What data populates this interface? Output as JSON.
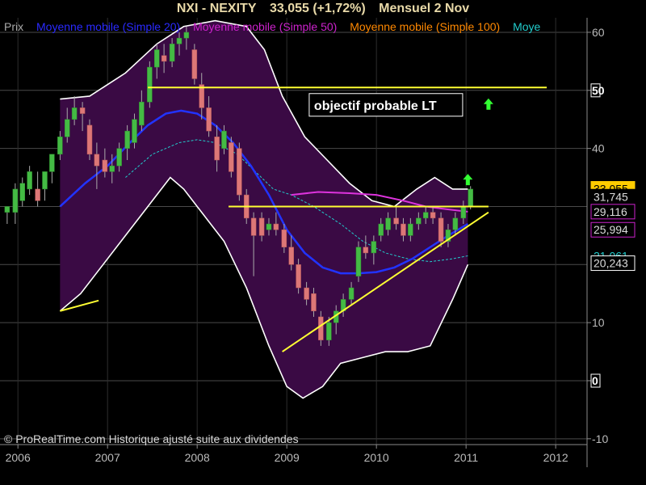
{
  "header": {
    "symbol": "NXI - NEXITY",
    "price_change": "33,055 (+1,72%)",
    "period": "Mensuel  2 Nov"
  },
  "legend": [
    {
      "label": "Prix",
      "color": "#aaaaaa"
    },
    {
      "label": "Moyenne mobile (Simple 20)",
      "color": "#2a2aff"
    },
    {
      "label": "Moyenne mobile (Simple 50)",
      "color": "#cc22cc"
    },
    {
      "label": "Moyenne mobile (Simple 100)",
      "color": "#ff8800"
    },
    {
      "label": "Moye",
      "color": "#22cccc"
    }
  ],
  "copyright": "© ProRealTime.com Historique ajusté suite aux dividendes",
  "annotation": {
    "text": "objectif probable LT",
    "x": 2009.25,
    "y": 47.5
  },
  "price_tags": [
    {
      "value": 33.055,
      "label": "33,055",
      "bg": "#ffcc00",
      "fg": "#000000",
      "border": "#ffcc00"
    },
    {
      "value": 31.7,
      "label": "31,745",
      "bg": "#000000",
      "fg": "#dddddd",
      "border": "#000000"
    },
    {
      "value": 29.116,
      "label": "29,116",
      "bg": "#000000",
      "fg": "#dddddd",
      "border": "#cc22cc"
    },
    {
      "value": 25.994,
      "label": "25,994",
      "bg": "#000000",
      "fg": "#dddddd",
      "border": "#cc22cc"
    },
    {
      "value": 21.5,
      "label": "21,061",
      "bg": "#000000",
      "fg": "#22cccc",
      "border": "#000000"
    },
    {
      "value": 20.243,
      "label": "20,243",
      "bg": "#000000",
      "fg": "#dddddd",
      "border": "#ffffff"
    }
  ],
  "chart_data": {
    "type": "candlestick",
    "x_axis": {
      "min": 2005.8,
      "max": 2012.35,
      "ticks": [
        "2006",
        "2007",
        "2008",
        "2009",
        "2010",
        "2011",
        "2012"
      ],
      "tick_values": [
        2006,
        2007,
        2008,
        2009,
        2010,
        2011,
        2012
      ]
    },
    "y_axis": {
      "min": -11,
      "max": 62.5,
      "ticks": [
        "60",
        "50",
        "40",
        "0",
        "10",
        "-10"
      ],
      "tick_values": [
        60,
        50,
        40,
        0,
        10,
        -10
      ],
      "highlight": [
        50,
        0
      ],
      "gridlines": [
        60,
        50,
        40,
        30,
        20,
        10,
        0,
        -10
      ]
    },
    "candles": [
      {
        "t": 2005.88,
        "o": 29,
        "h": 30,
        "l": 27,
        "c": 30
      },
      {
        "t": 2005.97,
        "o": 29,
        "h": 34,
        "l": 27,
        "c": 33
      },
      {
        "t": 2006.05,
        "o": 31,
        "h": 35,
        "l": 30,
        "c": 34
      },
      {
        "t": 2006.13,
        "o": 33,
        "h": 37,
        "l": 32,
        "c": 36
      },
      {
        "t": 2006.22,
        "o": 33,
        "h": 36,
        "l": 30,
        "c": 31
      },
      {
        "t": 2006.3,
        "o": 33,
        "h": 36,
        "l": 31,
        "c": 36
      },
      {
        "t": 2006.38,
        "o": 36,
        "h": 39,
        "l": 34,
        "c": 39
      },
      {
        "t": 2006.47,
        "o": 39,
        "h": 43,
        "l": 38,
        "c": 42
      },
      {
        "t": 2006.55,
        "o": 42,
        "h": 47,
        "l": 41,
        "c": 45
      },
      {
        "t": 2006.63,
        "o": 45,
        "h": 49,
        "l": 44,
        "c": 47
      },
      {
        "t": 2006.72,
        "o": 47,
        "h": 48,
        "l": 43,
        "c": 46
      },
      {
        "t": 2006.8,
        "o": 44,
        "h": 45,
        "l": 38,
        "c": 39
      },
      {
        "t": 2006.88,
        "o": 39,
        "h": 41,
        "l": 33,
        "c": 37
      },
      {
        "t": 2006.97,
        "o": 38,
        "h": 40,
        "l": 35,
        "c": 36
      },
      {
        "t": 2007.05,
        "o": 36,
        "h": 39,
        "l": 34,
        "c": 37
      },
      {
        "t": 2007.13,
        "o": 37,
        "h": 41,
        "l": 36,
        "c": 40
      },
      {
        "t": 2007.22,
        "o": 40,
        "h": 44,
        "l": 38,
        "c": 43
      },
      {
        "t": 2007.3,
        "o": 41,
        "h": 46,
        "l": 40,
        "c": 45
      },
      {
        "t": 2007.38,
        "o": 44,
        "h": 50,
        "l": 43,
        "c": 48
      },
      {
        "t": 2007.47,
        "o": 48,
        "h": 55,
        "l": 47,
        "c": 54
      },
      {
        "t": 2007.55,
        "o": 54,
        "h": 58,
        "l": 52,
        "c": 57
      },
      {
        "t": 2007.63,
        "o": 56,
        "h": 58,
        "l": 53,
        "c": 55
      },
      {
        "t": 2007.72,
        "o": 55,
        "h": 59,
        "l": 54,
        "c": 58
      },
      {
        "t": 2007.8,
        "o": 58,
        "h": 60,
        "l": 56,
        "c": 59
      },
      {
        "t": 2007.88,
        "o": 59,
        "h": 61,
        "l": 57,
        "c": 60
      },
      {
        "t": 2007.97,
        "o": 57,
        "h": 58,
        "l": 51,
        "c": 52
      },
      {
        "t": 2008.05,
        "o": 51,
        "h": 53,
        "l": 45,
        "c": 47
      },
      {
        "t": 2008.13,
        "o": 47,
        "h": 49,
        "l": 42,
        "c": 43
      },
      {
        "t": 2008.22,
        "o": 42,
        "h": 44,
        "l": 36,
        "c": 38
      },
      {
        "t": 2008.3,
        "o": 40,
        "h": 44,
        "l": 39,
        "c": 43
      },
      {
        "t": 2008.38,
        "o": 41,
        "h": 42,
        "l": 35,
        "c": 36
      },
      {
        "t": 2008.47,
        "o": 40,
        "h": 41,
        "l": 31,
        "c": 32
      },
      {
        "t": 2008.55,
        "o": 32,
        "h": 33,
        "l": 27,
        "c": 28
      },
      {
        "t": 2008.63,
        "o": 28,
        "h": 29,
        "l": 18,
        "c": 25
      },
      {
        "t": 2008.72,
        "o": 28,
        "h": 29,
        "l": 24,
        "c": 25
      },
      {
        "t": 2008.8,
        "o": 26,
        "h": 28,
        "l": 25,
        "c": 27
      },
      {
        "t": 2008.88,
        "o": 27,
        "h": 29,
        "l": 25,
        "c": 26
      },
      {
        "t": 2008.97,
        "o": 26,
        "h": 27,
        "l": 22,
        "c": 23
      },
      {
        "t": 2009.05,
        "o": 23,
        "h": 25,
        "l": 19,
        "c": 20
      },
      {
        "t": 2009.13,
        "o": 20,
        "h": 21,
        "l": 15,
        "c": 16
      },
      {
        "t": 2009.22,
        "o": 16,
        "h": 17,
        "l": 13,
        "c": 14
      },
      {
        "t": 2009.3,
        "o": 15,
        "h": 16,
        "l": 11,
        "c": 12
      },
      {
        "t": 2009.38,
        "o": 11,
        "h": 12,
        "l": 6,
        "c": 7
      },
      {
        "t": 2009.47,
        "o": 7,
        "h": 11,
        "l": 6,
        "c": 10
      },
      {
        "t": 2009.55,
        "o": 10,
        "h": 13,
        "l": 8,
        "c": 12
      },
      {
        "t": 2009.63,
        "o": 12,
        "h": 15,
        "l": 11,
        "c": 14
      },
      {
        "t": 2009.72,
        "o": 14,
        "h": 17,
        "l": 13,
        "c": 16
      },
      {
        "t": 2009.8,
        "o": 18,
        "h": 24,
        "l": 17,
        "c": 23
      },
      {
        "t": 2009.88,
        "o": 23,
        "h": 25,
        "l": 21,
        "c": 22
      },
      {
        "t": 2009.97,
        "o": 22,
        "h": 25,
        "l": 20,
        "c": 24
      },
      {
        "t": 2010.05,
        "o": 25,
        "h": 28,
        "l": 24,
        "c": 27
      },
      {
        "t": 2010.13,
        "o": 26,
        "h": 29,
        "l": 25,
        "c": 28
      },
      {
        "t": 2010.22,
        "o": 28,
        "h": 30,
        "l": 26,
        "c": 27
      },
      {
        "t": 2010.3,
        "o": 27,
        "h": 28,
        "l": 24,
        "c": 25
      },
      {
        "t": 2010.38,
        "o": 25,
        "h": 28,
        "l": 24,
        "c": 27
      },
      {
        "t": 2010.47,
        "o": 27,
        "h": 29,
        "l": 26,
        "c": 28
      },
      {
        "t": 2010.55,
        "o": 28,
        "h": 30,
        "l": 27,
        "c": 29
      },
      {
        "t": 2010.63,
        "o": 29,
        "h": 30,
        "l": 27,
        "c": 28
      },
      {
        "t": 2010.72,
        "o": 28,
        "h": 29,
        "l": 23,
        "c": 24
      },
      {
        "t": 2010.8,
        "o": 24,
        "h": 27,
        "l": 23,
        "c": 26
      },
      {
        "t": 2010.88,
        "o": 26,
        "h": 29,
        "l": 25,
        "c": 28
      },
      {
        "t": 2010.97,
        "o": 28,
        "h": 31,
        "l": 27,
        "c": 30
      },
      {
        "t": 2011.05,
        "o": 30,
        "h": 33.5,
        "l": 29.5,
        "c": 33
      }
    ],
    "bollinger_upper": [
      [
        2006.47,
        48.5
      ],
      [
        2006.8,
        49
      ],
      [
        2007.2,
        53
      ],
      [
        2007.55,
        58
      ],
      [
        2007.85,
        61
      ],
      [
        2008.2,
        62
      ],
      [
        2008.55,
        61
      ],
      [
        2008.75,
        57
      ],
      [
        2008.95,
        49
      ],
      [
        2009.2,
        42
      ],
      [
        2009.45,
        38
      ],
      [
        2009.7,
        34
      ],
      [
        2009.95,
        31
      ],
      [
        2010.2,
        30
      ],
      [
        2010.45,
        33
      ],
      [
        2010.65,
        35
      ],
      [
        2010.85,
        33
      ],
      [
        2011.02,
        33
      ]
    ],
    "bollinger_lower": [
      [
        2006.47,
        12
      ],
      [
        2006.7,
        15
      ],
      [
        2006.95,
        20
      ],
      [
        2007.2,
        25
      ],
      [
        2007.5,
        31
      ],
      [
        2007.7,
        35
      ],
      [
        2007.85,
        33
      ],
      [
        2008.05,
        29
      ],
      [
        2008.3,
        24
      ],
      [
        2008.55,
        16
      ],
      [
        2008.8,
        6
      ],
      [
        2009.0,
        -1
      ],
      [
        2009.18,
        -3
      ],
      [
        2009.4,
        -1
      ],
      [
        2009.6,
        3
      ],
      [
        2009.85,
        4
      ],
      [
        2010.1,
        5
      ],
      [
        2010.35,
        5
      ],
      [
        2010.6,
        6
      ],
      [
        2010.85,
        14
      ],
      [
        2011.02,
        20
      ]
    ],
    "ma20": [
      [
        2006.47,
        30
      ],
      [
        2006.75,
        34
      ],
      [
        2007.0,
        37
      ],
      [
        2007.25,
        41
      ],
      [
        2007.45,
        44
      ],
      [
        2007.65,
        46
      ],
      [
        2007.82,
        46.5
      ],
      [
        2008.0,
        46
      ],
      [
        2008.2,
        44
      ],
      [
        2008.4,
        41
      ],
      [
        2008.6,
        37
      ],
      [
        2008.8,
        32
      ],
      [
        2009.0,
        26
      ],
      [
        2009.2,
        22
      ],
      [
        2009.4,
        19.5
      ],
      [
        2009.6,
        18.5
      ],
      [
        2009.8,
        18.5
      ],
      [
        2010.0,
        18.7
      ],
      [
        2010.2,
        19.5
      ],
      [
        2010.4,
        21
      ],
      [
        2010.6,
        23
      ],
      [
        2010.8,
        25
      ],
      [
        2011.02,
        27
      ]
    ],
    "ma50": [
      [
        2009.05,
        32
      ],
      [
        2009.35,
        32.5
      ],
      [
        2009.7,
        32.3
      ],
      [
        2010.0,
        32
      ],
      [
        2010.3,
        31
      ],
      [
        2010.55,
        30
      ],
      [
        2010.8,
        29.5
      ],
      [
        2011.02,
        29.1
      ]
    ],
    "ma100_dashed": [
      [
        2007.2,
        35
      ],
      [
        2007.5,
        39
      ],
      [
        2007.8,
        41
      ],
      [
        2008.0,
        41.5
      ],
      [
        2008.2,
        41
      ],
      [
        2008.45,
        39
      ],
      [
        2008.65,
        36
      ],
      [
        2008.85,
        33
      ],
      [
        2009.05,
        32
      ],
      [
        2009.3,
        30
      ],
      [
        2009.6,
        27
      ],
      [
        2009.85,
        24
      ],
      [
        2010.1,
        22
      ],
      [
        2010.35,
        21
      ],
      [
        2010.6,
        20.5
      ],
      [
        2010.85,
        21
      ],
      [
        2011.02,
        21.5
      ]
    ],
    "lines": [
      {
        "name": "objectif",
        "color": "#ffff33",
        "points": [
          [
            2007.45,
            50.5
          ],
          [
            2011.9,
            50.5
          ]
        ]
      },
      {
        "name": "horizontal-support",
        "color": "#ffff33",
        "points": [
          [
            2008.35,
            30.0
          ],
          [
            2011.25,
            30.0
          ]
        ]
      },
      {
        "name": "trendline",
        "color": "#ffff33",
        "points": [
          [
            2008.95,
            5.0
          ],
          [
            2011.25,
            29.0
          ]
        ]
      },
      {
        "name": "old-segment",
        "color": "#ffff33",
        "points": [
          [
            2006.47,
            12
          ],
          [
            2006.9,
            13.8
          ]
        ]
      }
    ],
    "arrows": [
      {
        "t": 2011.25,
        "y": 47.5,
        "color": "#33ff33"
      },
      {
        "t": 2011.02,
        "y": 34.5,
        "color": "#33ff33"
      }
    ]
  }
}
